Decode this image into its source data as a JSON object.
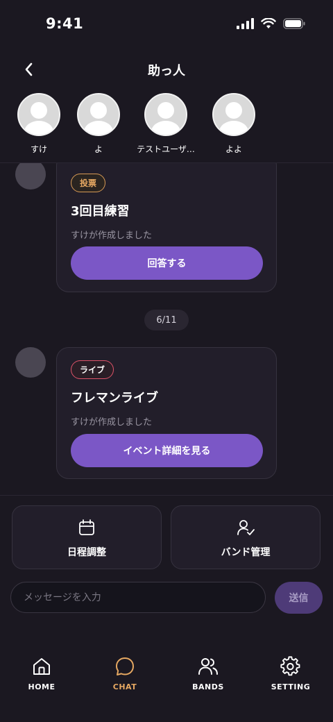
{
  "status": {
    "time": "9:41"
  },
  "header": {
    "title": "助っ人"
  },
  "members": [
    {
      "name": "すけ"
    },
    {
      "name": "よ"
    },
    {
      "name": "テストユーザ…"
    },
    {
      "name": "よよ"
    }
  ],
  "messages": [
    {
      "badge": "投票",
      "title": "3回目練習",
      "subtitle": "すけが作成しました",
      "button": "回答する"
    },
    {
      "badge": "ライブ",
      "title": "フレマンライブ",
      "subtitle": "すけが作成しました",
      "button": "イベント詳細を見る"
    }
  ],
  "date_separator": "6/11",
  "actions": [
    {
      "label": "日程調整",
      "icon": "calendar-icon"
    },
    {
      "label": "バンド管理",
      "icon": "user-check-icon"
    }
  ],
  "input": {
    "placeholder": "メッセージを入力",
    "send": "送信"
  },
  "nav": [
    {
      "label": "HOME",
      "icon": "home-icon",
      "active": false
    },
    {
      "label": "CHAT",
      "icon": "chat-icon",
      "active": true
    },
    {
      "label": "BANDS",
      "icon": "users-icon",
      "active": false
    },
    {
      "label": "SETTING",
      "icon": "gear-icon",
      "active": false
    }
  ],
  "colors": {
    "background": "#1b1821",
    "card": "#221e2a",
    "accent_purple": "#7b57c6",
    "active_nav": "#e6a862",
    "vote_badge": "#d79a55",
    "live_badge": "#e0546a"
  }
}
